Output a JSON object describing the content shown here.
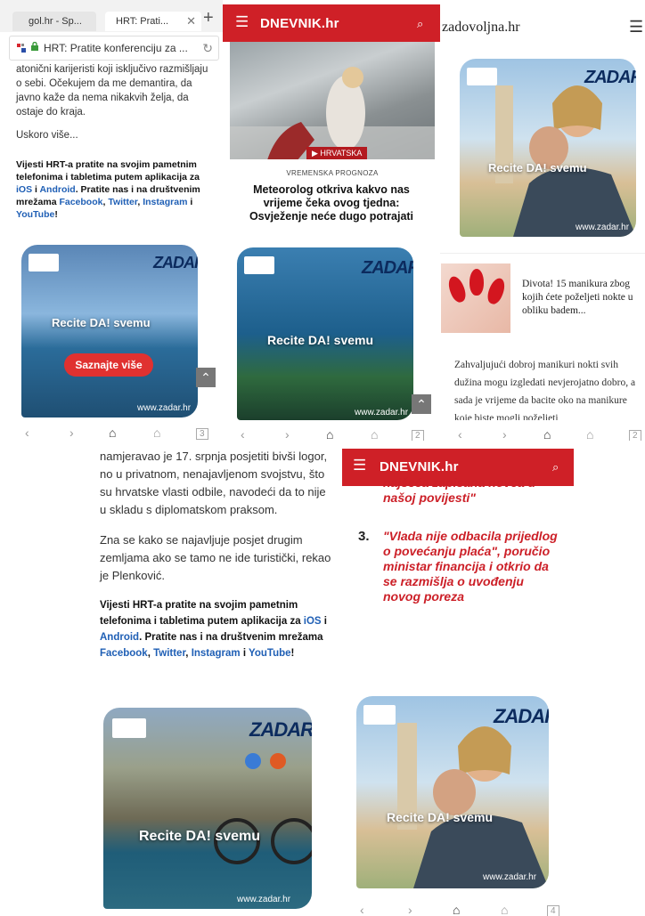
{
  "shot1": {
    "tabs": [
      {
        "label": "gol.hr - Sp..."
      },
      {
        "label": "HRT: Prati..."
      }
    ],
    "url": "HRT: Pratite konferenciju za ...",
    "article": {
      "p1": "atonični karijeristi koji isključivo razmišljaju o sebi. Očekujem da me demantira, da javno kaže da nema nikakvih želja, da ostaje do kraja.",
      "p2": "Uskoro više...",
      "promo_a": "Vijesti HRT-a pratite na svojim pametnim telefonima i tabletima putem aplikacija za ",
      "promo_ios": "iOS",
      "promo_i": " i ",
      "promo_android": "Android",
      "promo_b": ". Pratite nas i na društvenim mrežama ",
      "promo_fb": "Facebook",
      "promo_c": ", ",
      "promo_tw": "Twitter",
      "promo_d": ", ",
      "promo_ig": "Instagram",
      "promo_e": " i ",
      "promo_yt": "YouTube",
      "promo_f": "!"
    },
    "ad": {
      "brand": "ZADAR",
      "tagline": "Recite DA! svemu",
      "cta": "Saznajte više",
      "url": "www.zadar.hr"
    },
    "tab_count": "3"
  },
  "shot2": {
    "logo": "DNEVNIK.hr",
    "tag": "HRVATSKA",
    "kicker": "VREMENSKA PROGNOZA",
    "title": "Meteorolog otkriva kakvo nas vrijeme čeka ovog tjedna: Osvježenje neće dugo potrajati",
    "ad": {
      "brand": "ZADAR",
      "tagline": "Recite DA! svemu",
      "url": "www.zadar.hr"
    },
    "tab_count": "2"
  },
  "shot3": {
    "logo": "zadovoljna.hr",
    "ad": {
      "brand": "ZADAR",
      "tagline": "Recite DA! svemu",
      "url": "www.zadar.hr"
    },
    "card_title": "Divota! 15 manikura zbog kojih ćete poželjeti nokte u obliku badem...",
    "body": "Zahvaljujući dobroj manikuri nokti svih dužina mogu izgledati nevjerojatno dobro, a sada je vrijeme da bacite oko na manikure koje biste mogli poželjeti",
    "tab_count": "2"
  },
  "shot4": {
    "p1": "namjeravao je 17. srpnja posjetiti bivši logor, no u privatnom, nenajavljenom svojstvu, što su hrvatske vlasti odbile, navodeći da to nije u skladu s diplomatskom praksom.",
    "p2": "Zna se kako se najavljuje posjet drugim zemljama ako se tamo ne ide turistički, rekao je Plenković.",
    "promo_a": "Vijesti HRT-a pratite na svojim pametnim telefonima i tabletima putem aplikacija za ",
    "promo_ios": "iOS",
    "promo_i": " i ",
    "promo_android": "Android",
    "promo_b": ". Pratite nas i na društvenim mrežama ",
    "promo_fb": "Facebook",
    "promo_c": ", ",
    "promo_tw": "Twitter",
    "promo_d": ", ",
    "promo_ig": "Instagram",
    "promo_e": " i ",
    "promo_yt": "YouTube",
    "promo_f": "!",
    "ad": {
      "brand": "ZADAR",
      "tagline": "Recite DA! svemu",
      "url": "www.zadar.hr"
    }
  },
  "shot5": {
    "logo": "DNEVNIK.hr",
    "prev_item_tail": "najšeća zapisana novca u našoj povijesti\"",
    "item_num": "3.",
    "item_text": "\"Vlada nije odbacila prijedlog o povećanju plaća\", poručio ministar financija i otkrio da se razmišlja o uvođenju novog poreza",
    "ad": {
      "brand": "ZADAR",
      "tagline": "Recite DA! svemu",
      "url": "www.zadar.hr"
    },
    "tab_count": "4"
  },
  "colors": {
    "dnevnik_red": "#cf2027",
    "hrt_blue": "#1f5fb5",
    "zadar_navy": "#0c2b5e"
  }
}
